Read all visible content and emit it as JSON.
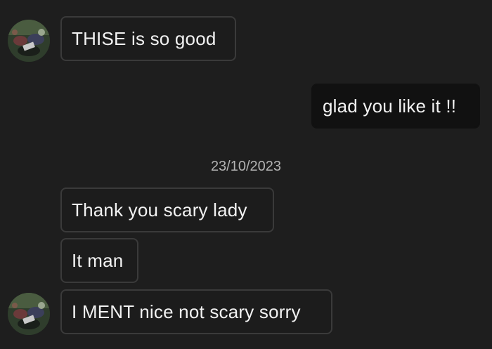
{
  "conversation": {
    "date_separator": "23/10/2023",
    "messages": [
      {
        "sender": "them",
        "text": "THISE is so good",
        "show_avatar": true
      },
      {
        "sender": "me",
        "text": "glad you like it !!"
      },
      {
        "sender": "them",
        "text": "Thank you scary lady",
        "show_avatar": false
      },
      {
        "sender": "them",
        "text": "It man",
        "show_avatar": false
      },
      {
        "sender": "them",
        "text": "I MENT nice not scary sorry",
        "show_avatar": true
      }
    ]
  },
  "avatar": {
    "icon": "contact-avatar-photo"
  }
}
